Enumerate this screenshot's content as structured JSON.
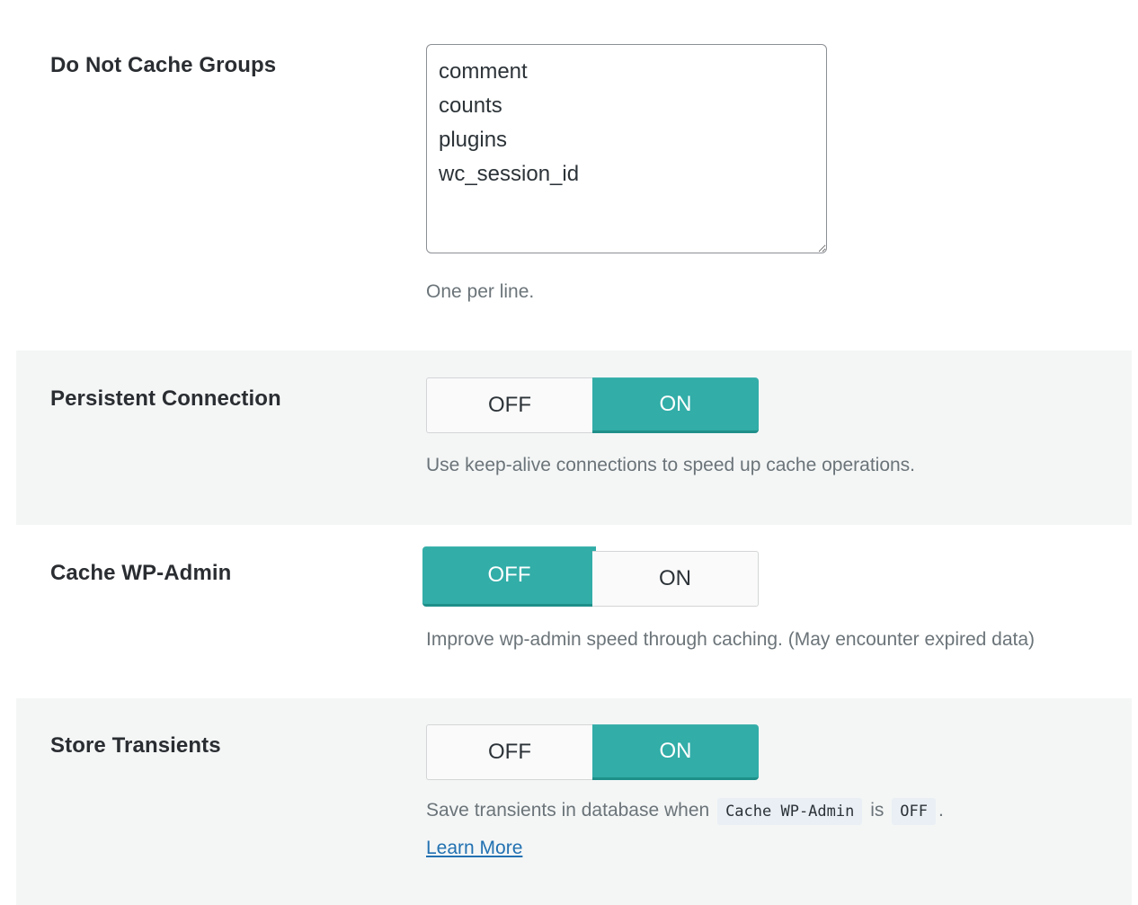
{
  "rows": {
    "groups": {
      "label": "Do Not Cache Groups",
      "value": "comment\ncounts\nplugins\nwc_session_id",
      "description": "One per line."
    },
    "persistent": {
      "label": "Persistent Connection",
      "off_label": "OFF",
      "on_label": "ON",
      "state": "ON",
      "description": "Use keep-alive connections to speed up cache operations."
    },
    "wp_admin": {
      "label": "Cache WP-Admin",
      "off_label": "OFF",
      "on_label": "ON",
      "state": "OFF",
      "description": "Improve wp-admin speed through caching. (May encounter expired data)"
    },
    "transients": {
      "label": "Store Transients",
      "off_label": "OFF",
      "on_label": "ON",
      "state": "ON",
      "description_prefix": "Save transients in database when",
      "code_setting": "Cache WP-Admin",
      "description_is": "is",
      "code_value": "OFF",
      "description_suffix": ".",
      "learn_more": "Learn More"
    }
  },
  "colors": {
    "accent": "#32ada8",
    "row_alt_background": "#f4f6f6",
    "link": "#2271b1"
  }
}
